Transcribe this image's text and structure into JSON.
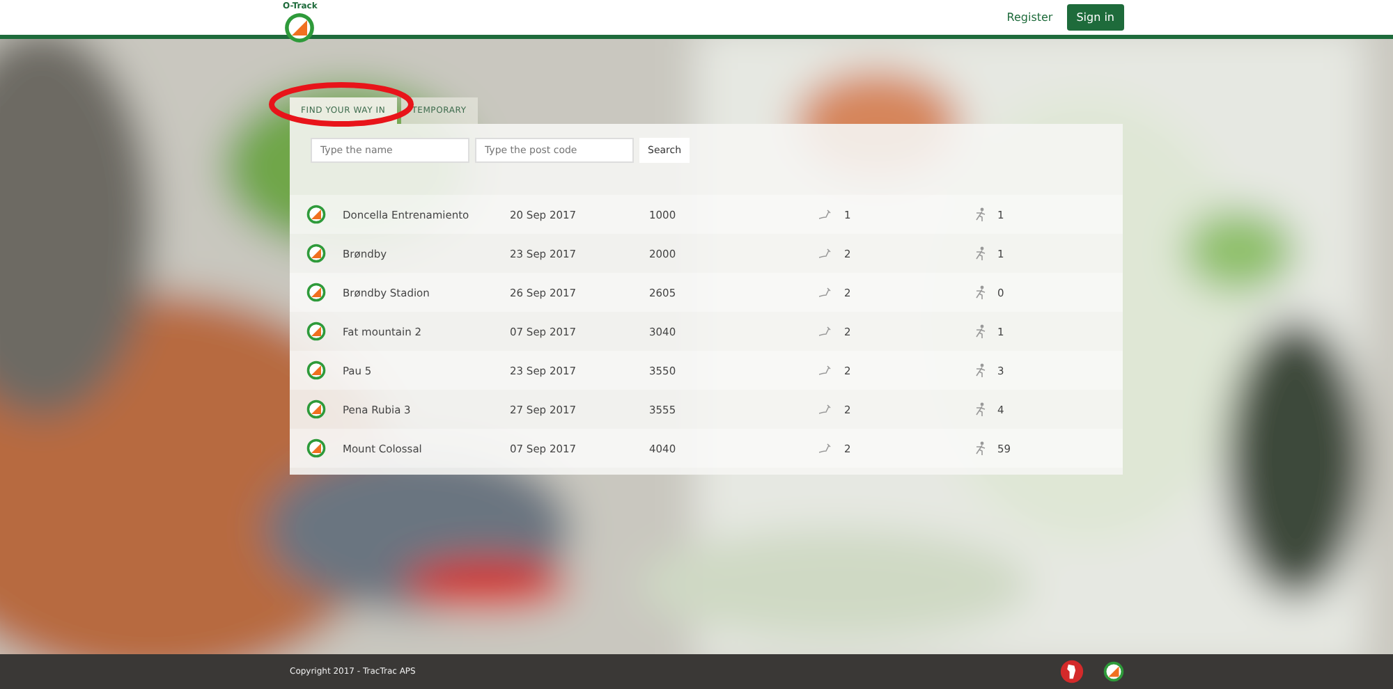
{
  "header": {
    "logo_text": "O-Track",
    "links": [
      {
        "label": "Register",
        "kind": "link"
      },
      {
        "label": "Sign in",
        "kind": "button"
      }
    ]
  },
  "tabs": [
    {
      "label": "FIND YOUR WAY IN",
      "selected": true,
      "annotated": true
    },
    {
      "label": "TEMPORARY",
      "selected": false,
      "annotated": false
    }
  ],
  "search": {
    "name_placeholder": "Type the name",
    "postcode_placeholder": "Type the post code",
    "button": "Search"
  },
  "rows": [
    {
      "name": "Doncella Entrenamiento",
      "date": "20 Sep 2017",
      "code": "1000",
      "routes": "1",
      "runners": "1"
    },
    {
      "name": "Brøndby",
      "date": "23 Sep 2017",
      "code": "2000",
      "routes": "2",
      "runners": "1"
    },
    {
      "name": "Brøndby Stadion",
      "date": "26 Sep 2017",
      "code": "2605",
      "routes": "2",
      "runners": "0"
    },
    {
      "name": "Fat mountain 2",
      "date": "07 Sep 2017",
      "code": "3040",
      "routes": "2",
      "runners": "1"
    },
    {
      "name": "Pau 5",
      "date": "23 Sep 2017",
      "code": "3550",
      "routes": "2",
      "runners": "3"
    },
    {
      "name": "Pena Rubia 3",
      "date": "27 Sep 2017",
      "code": "3555",
      "routes": "2",
      "runners": "4"
    },
    {
      "name": "Mount Colossal",
      "date": "07 Sep 2017",
      "code": "4040",
      "routes": "2",
      "runners": "59"
    }
  ],
  "footer": {
    "copyright": "Copyright 2017 - TracTrac APS"
  }
}
